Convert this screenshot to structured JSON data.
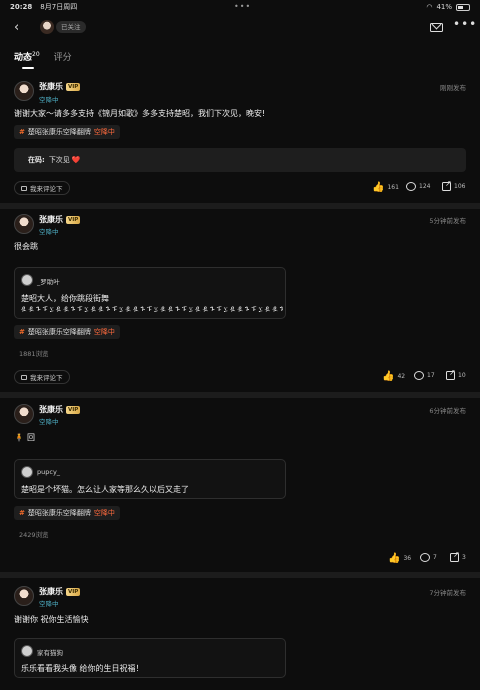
{
  "status_bar": {
    "time": "20:28",
    "date": "8月7日周四",
    "battery": "41%"
  },
  "nav": {
    "follow_status": "已关注"
  },
  "tabs": [
    {
      "label": "动态",
      "count": "20"
    },
    {
      "label": "评分"
    }
  ],
  "posts": [
    {
      "username": "张康乐",
      "vip": "VIP",
      "subtitle": "空降中",
      "time": "刚刚发布",
      "text": "谢谢大家～请多多支持《锦月如歌》多多支持楚昭，我们下次见，晚安!",
      "topic": {
        "name": "楚昭张康乐空降翻牌",
        "tag": "空降中"
      },
      "comment": {
        "author": "在码:",
        "text": "下次见",
        "emoji": "❤️"
      },
      "comment_button": "我来评论下",
      "likes": "161",
      "comments": "124",
      "shares": "106"
    },
    {
      "username": "张康乐",
      "vip": "VIP",
      "subtitle": "空降中",
      "time": "5分钟前发布",
      "text": "很会跳",
      "quote": {
        "name": "_罗助叶",
        "line1": "楚昭大人，给你跳段街舞",
        "line2": "ዷ ዷ ጉ ፑ ፲ ዷ ዷ ጉ ፑ ፲ ዷ ዷ ጉ ፑ ፲ ዷ ዷ ጉ ፑ ፲ ዷ ዷ ጉ ፑ ፲ ዷ ዷ ጉ ፑ ፲ ዷ ዷ ጉ ፑ ፲ ዷ ዷ ጉ ፑ"
      },
      "topic": {
        "name": "楚昭张康乐空降翻牌",
        "tag": "空降中"
      },
      "views": "1881浏览",
      "comment_button": "我来评论下",
      "likes": "42",
      "comments": "17",
      "shares": "10"
    },
    {
      "username": "张康乐",
      "vip": "VIP",
      "subtitle": "空降中",
      "time": "6分钟前发布",
      "text": "回",
      "quote": {
        "name": "pupcy_",
        "line1": "楚昭是个坏猫。怎么让人家等那么久以后又走了"
      },
      "topic": {
        "name": "楚昭张康乐空降翻牌",
        "tag": "空降中"
      },
      "views": "2429浏览",
      "likes": "36",
      "comments": "7",
      "shares": "3"
    },
    {
      "username": "张康乐",
      "vip": "VIP",
      "subtitle": "空降中",
      "time": "7分钟前发布",
      "text": "谢谢你 祝你生活愉快",
      "quote": {
        "name": "家有猫狗",
        "line1": "乐乐看看我头像 给你的生日祝福！"
      }
    }
  ]
}
